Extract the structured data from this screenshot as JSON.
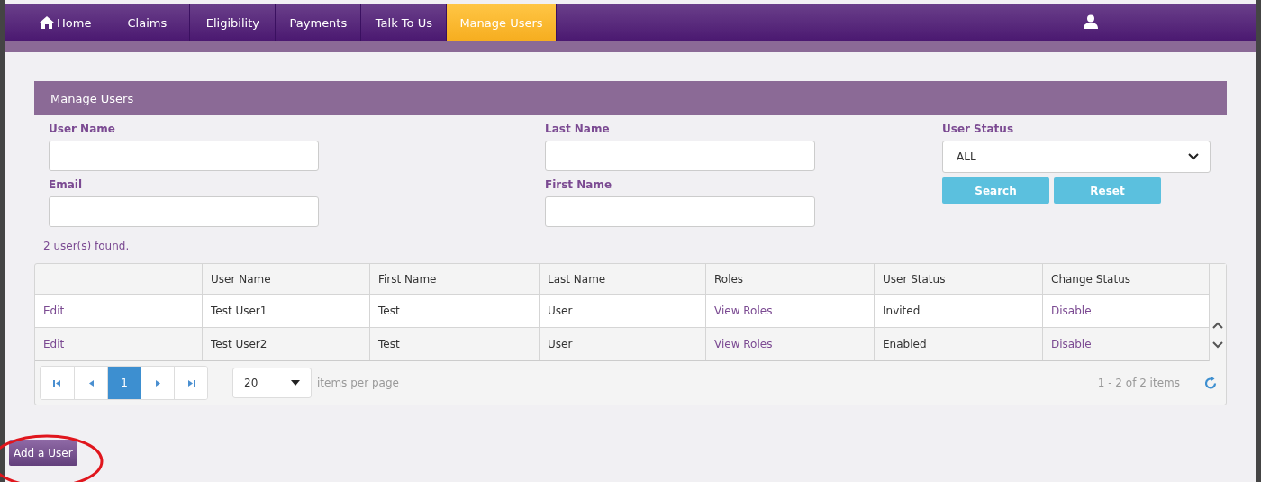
{
  "nav": {
    "tabs": [
      {
        "label": "Home",
        "kind": "home",
        "selected": false
      },
      {
        "label": "Claims",
        "kind": "text",
        "selected": false
      },
      {
        "label": "Eligibility",
        "kind": "text",
        "selected": false
      },
      {
        "label": "Payments",
        "kind": "text",
        "selected": false
      },
      {
        "label": "Talk To Us",
        "kind": "text",
        "selected": false
      },
      {
        "label": "Manage Users",
        "kind": "text",
        "selected": true
      }
    ]
  },
  "panel": {
    "title": "Manage Users",
    "fields": [
      {
        "label": "User Name"
      },
      {
        "label": "Last Name"
      },
      {
        "label": "Email"
      },
      {
        "label": "First Name"
      }
    ],
    "user_status": {
      "label": "User Status",
      "value": "ALL"
    },
    "buttons": [
      "Search",
      "Reset"
    ]
  },
  "result_count": "2 user(s) found.",
  "table": {
    "columns": [
      "",
      "User Name",
      "First Name",
      "Last Name",
      "Roles",
      "User Status",
      "Change Status"
    ],
    "rows": [
      {
        "cells": [
          {
            "text": "Edit",
            "kind": "link"
          },
          {
            "text": "Test User1",
            "kind": "text"
          },
          {
            "text": "Test",
            "kind": "text"
          },
          {
            "text": "User",
            "kind": "text"
          },
          {
            "text": "View Roles",
            "kind": "link"
          },
          {
            "text": "Invited",
            "kind": "text"
          },
          {
            "text": "Disable",
            "kind": "link"
          }
        ]
      },
      {
        "cells": [
          {
            "text": "Edit",
            "kind": "link"
          },
          {
            "text": "Test User2",
            "kind": "text"
          },
          {
            "text": "Test",
            "kind": "text"
          },
          {
            "text": "User",
            "kind": "text"
          },
          {
            "text": "View Roles",
            "kind": "link"
          },
          {
            "text": "Enabled",
            "kind": "text"
          },
          {
            "text": "Disable",
            "kind": "link"
          }
        ]
      }
    ]
  },
  "pager": {
    "pages": [
      {
        "label": "1",
        "selected": true
      }
    ],
    "page_size": "20",
    "page_size_label": "items per page",
    "summary": "1 - 2 of 2 items"
  },
  "add_button": "Add a User"
}
